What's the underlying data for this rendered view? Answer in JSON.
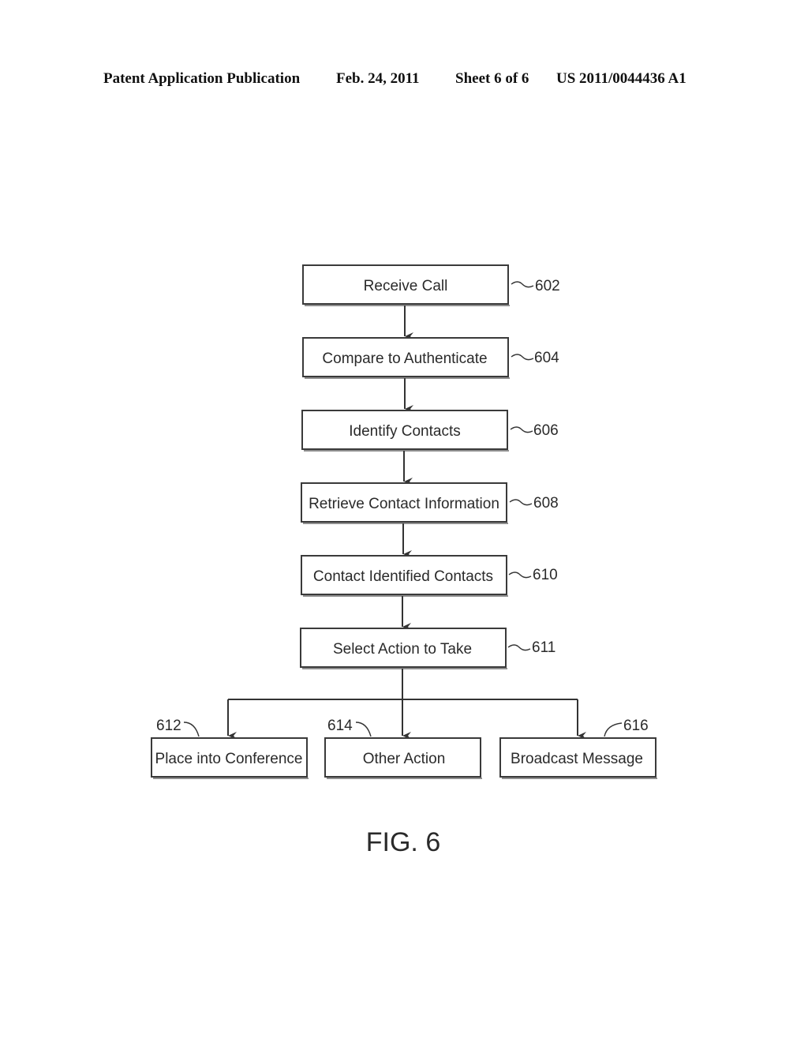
{
  "header": {
    "publication_type": "Patent Application Publication",
    "date": "Feb. 24, 2011",
    "sheet": "Sheet 6 of 6",
    "patent_number": "US 2011/0044436 A1"
  },
  "figure": {
    "caption": "FIG. 6",
    "steps": [
      {
        "id": "602",
        "label": "Receive Call"
      },
      {
        "id": "604",
        "label": "Compare to Authenticate"
      },
      {
        "id": "606",
        "label": "Identify Contacts"
      },
      {
        "id": "608",
        "label": "Retrieve Contact Information"
      },
      {
        "id": "610",
        "label": "Contact Identified Contacts"
      },
      {
        "id": "611",
        "label": "Select Action to Take"
      }
    ],
    "actions": [
      {
        "id": "612",
        "label": "Place into Conference"
      },
      {
        "id": "614",
        "label": "Other Action"
      },
      {
        "id": "616",
        "label": "Broadcast Message"
      }
    ]
  }
}
